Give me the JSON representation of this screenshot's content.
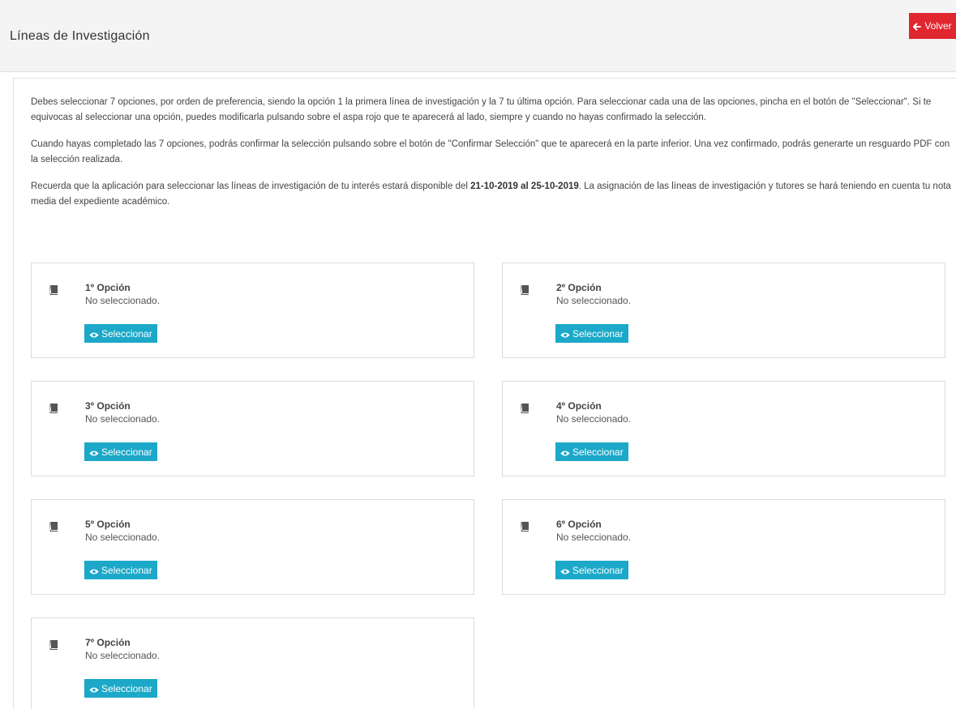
{
  "header": {
    "title": "Líneas de Investigación",
    "back_label": "Volver"
  },
  "intro": {
    "p1": "Debes seleccionar 7 opciones, por orden de preferencia, siendo la opción 1 la primera línea de investigación y la 7 tu última opción. Para seleccionar cada una de las opciones, pincha en el botón de \"Seleccionar\". Si te equivocas al seleccionar una opción, puedes modificarla pulsando sobre el aspa rojo que te aparecerá al lado, siempre y cuando no hayas confirmado la selección.",
    "p2": "Cuando hayas completado las 7 opciones, podrás confirmar la selección pulsando sobre el botón de \"Confirmar Selección\" que te aparecerá en la parte inferior. Una vez confirmado, podrás generarte un resguardo PDF con la selección realizada.",
    "p3_before": "Recuerda que la aplicación para seleccionar las líneas de investigación de tu interés estará disponible del ",
    "p3_dates": "21-10-2019 al 25-10-2019",
    "p3_after": ". La asignación de las líneas de investigación y tutores se hará teniendo en cuenta tu nota media del expediente académico."
  },
  "options": [
    {
      "title": "1º Opción",
      "status": "No seleccionado.",
      "button": "Seleccionar"
    },
    {
      "title": "2º Opción",
      "status": "No seleccionado.",
      "button": "Seleccionar"
    },
    {
      "title": "3º Opción",
      "status": "No seleccionado.",
      "button": "Seleccionar"
    },
    {
      "title": "4º Opción",
      "status": "No seleccionado.",
      "button": "Seleccionar"
    },
    {
      "title": "5º Opción",
      "status": "No seleccionado.",
      "button": "Seleccionar"
    },
    {
      "title": "6º Opción",
      "status": "No seleccionado.",
      "button": "Seleccionar"
    },
    {
      "title": "7º Opción",
      "status": "No seleccionado.",
      "button": "Seleccionar"
    }
  ],
  "icons": {
    "back": "arrow-left-icon",
    "option": "book-icon",
    "select": "eye-icon"
  },
  "colors": {
    "back_button": "#e0262e",
    "select_button": "#1ca8c8",
    "header_bg": "#f4f4f4"
  }
}
